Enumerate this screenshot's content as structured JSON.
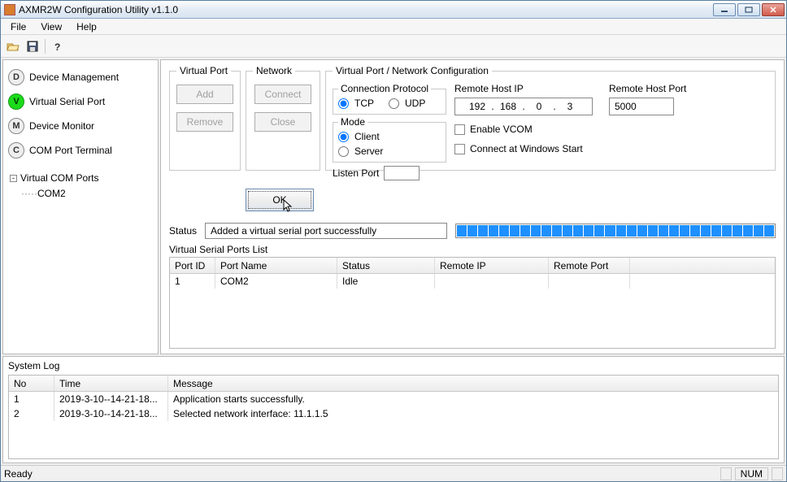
{
  "window": {
    "title": "AXMR2W Configuration Utility v1.1.0"
  },
  "menu": {
    "file": "File",
    "view": "View",
    "help": "Help"
  },
  "sidebar": {
    "items": [
      {
        "letter": "D",
        "label": "Device Management"
      },
      {
        "letter": "V",
        "label": "Virtual Serial Port"
      },
      {
        "letter": "M",
        "label": "Device Monitor"
      },
      {
        "letter": "C",
        "label": "COM Port Terminal"
      }
    ],
    "tree_root": "Virtual COM Ports",
    "tree_child": "COM2"
  },
  "groups": {
    "virtual_port": {
      "legend": "Virtual Port",
      "add": "Add",
      "remove": "Remove"
    },
    "network": {
      "legend": "Network",
      "connect": "Connect",
      "close": "Close",
      "ok": "OK"
    },
    "config": {
      "legend": "Virtual Port / Network Configuration",
      "protocol_legend": "Connection Protocol",
      "tcp": "TCP",
      "udp": "UDP",
      "mode_legend": "Mode",
      "client": "Client",
      "server": "Server",
      "listen_port": "Listen Port",
      "remote_ip_label": "Remote Host IP",
      "remote_ip": [
        "192",
        "168",
        "0",
        "3"
      ],
      "enable_vcom": "Enable VCOM",
      "connect_start": "Connect at Windows Start",
      "remote_port_label": "Remote Host Port",
      "remote_port": "5000"
    }
  },
  "status": {
    "label": "Status",
    "text": "Added a virtual serial port successfully"
  },
  "vsl": {
    "label": "Virtual Serial Ports List",
    "headers": {
      "portid": "Port ID",
      "portname": "Port Name",
      "status": "Status",
      "rip": "Remote IP",
      "rport": "Remote Port"
    },
    "rows": [
      {
        "portid": "1",
        "portname": "COM2",
        "status": "Idle",
        "rip": "",
        "rport": ""
      }
    ]
  },
  "syslog": {
    "label": "System Log",
    "headers": {
      "no": "No",
      "time": "Time",
      "msg": "Message"
    },
    "rows": [
      {
        "no": "1",
        "time": "2019-3-10--14-21-18...",
        "msg": "Application starts successfully."
      },
      {
        "no": "2",
        "time": "2019-3-10--14-21-18...",
        "msg": "Selected network interface: 11.1.1.5"
      }
    ]
  },
  "statusbar": {
    "ready": "Ready",
    "num": "NUM"
  }
}
